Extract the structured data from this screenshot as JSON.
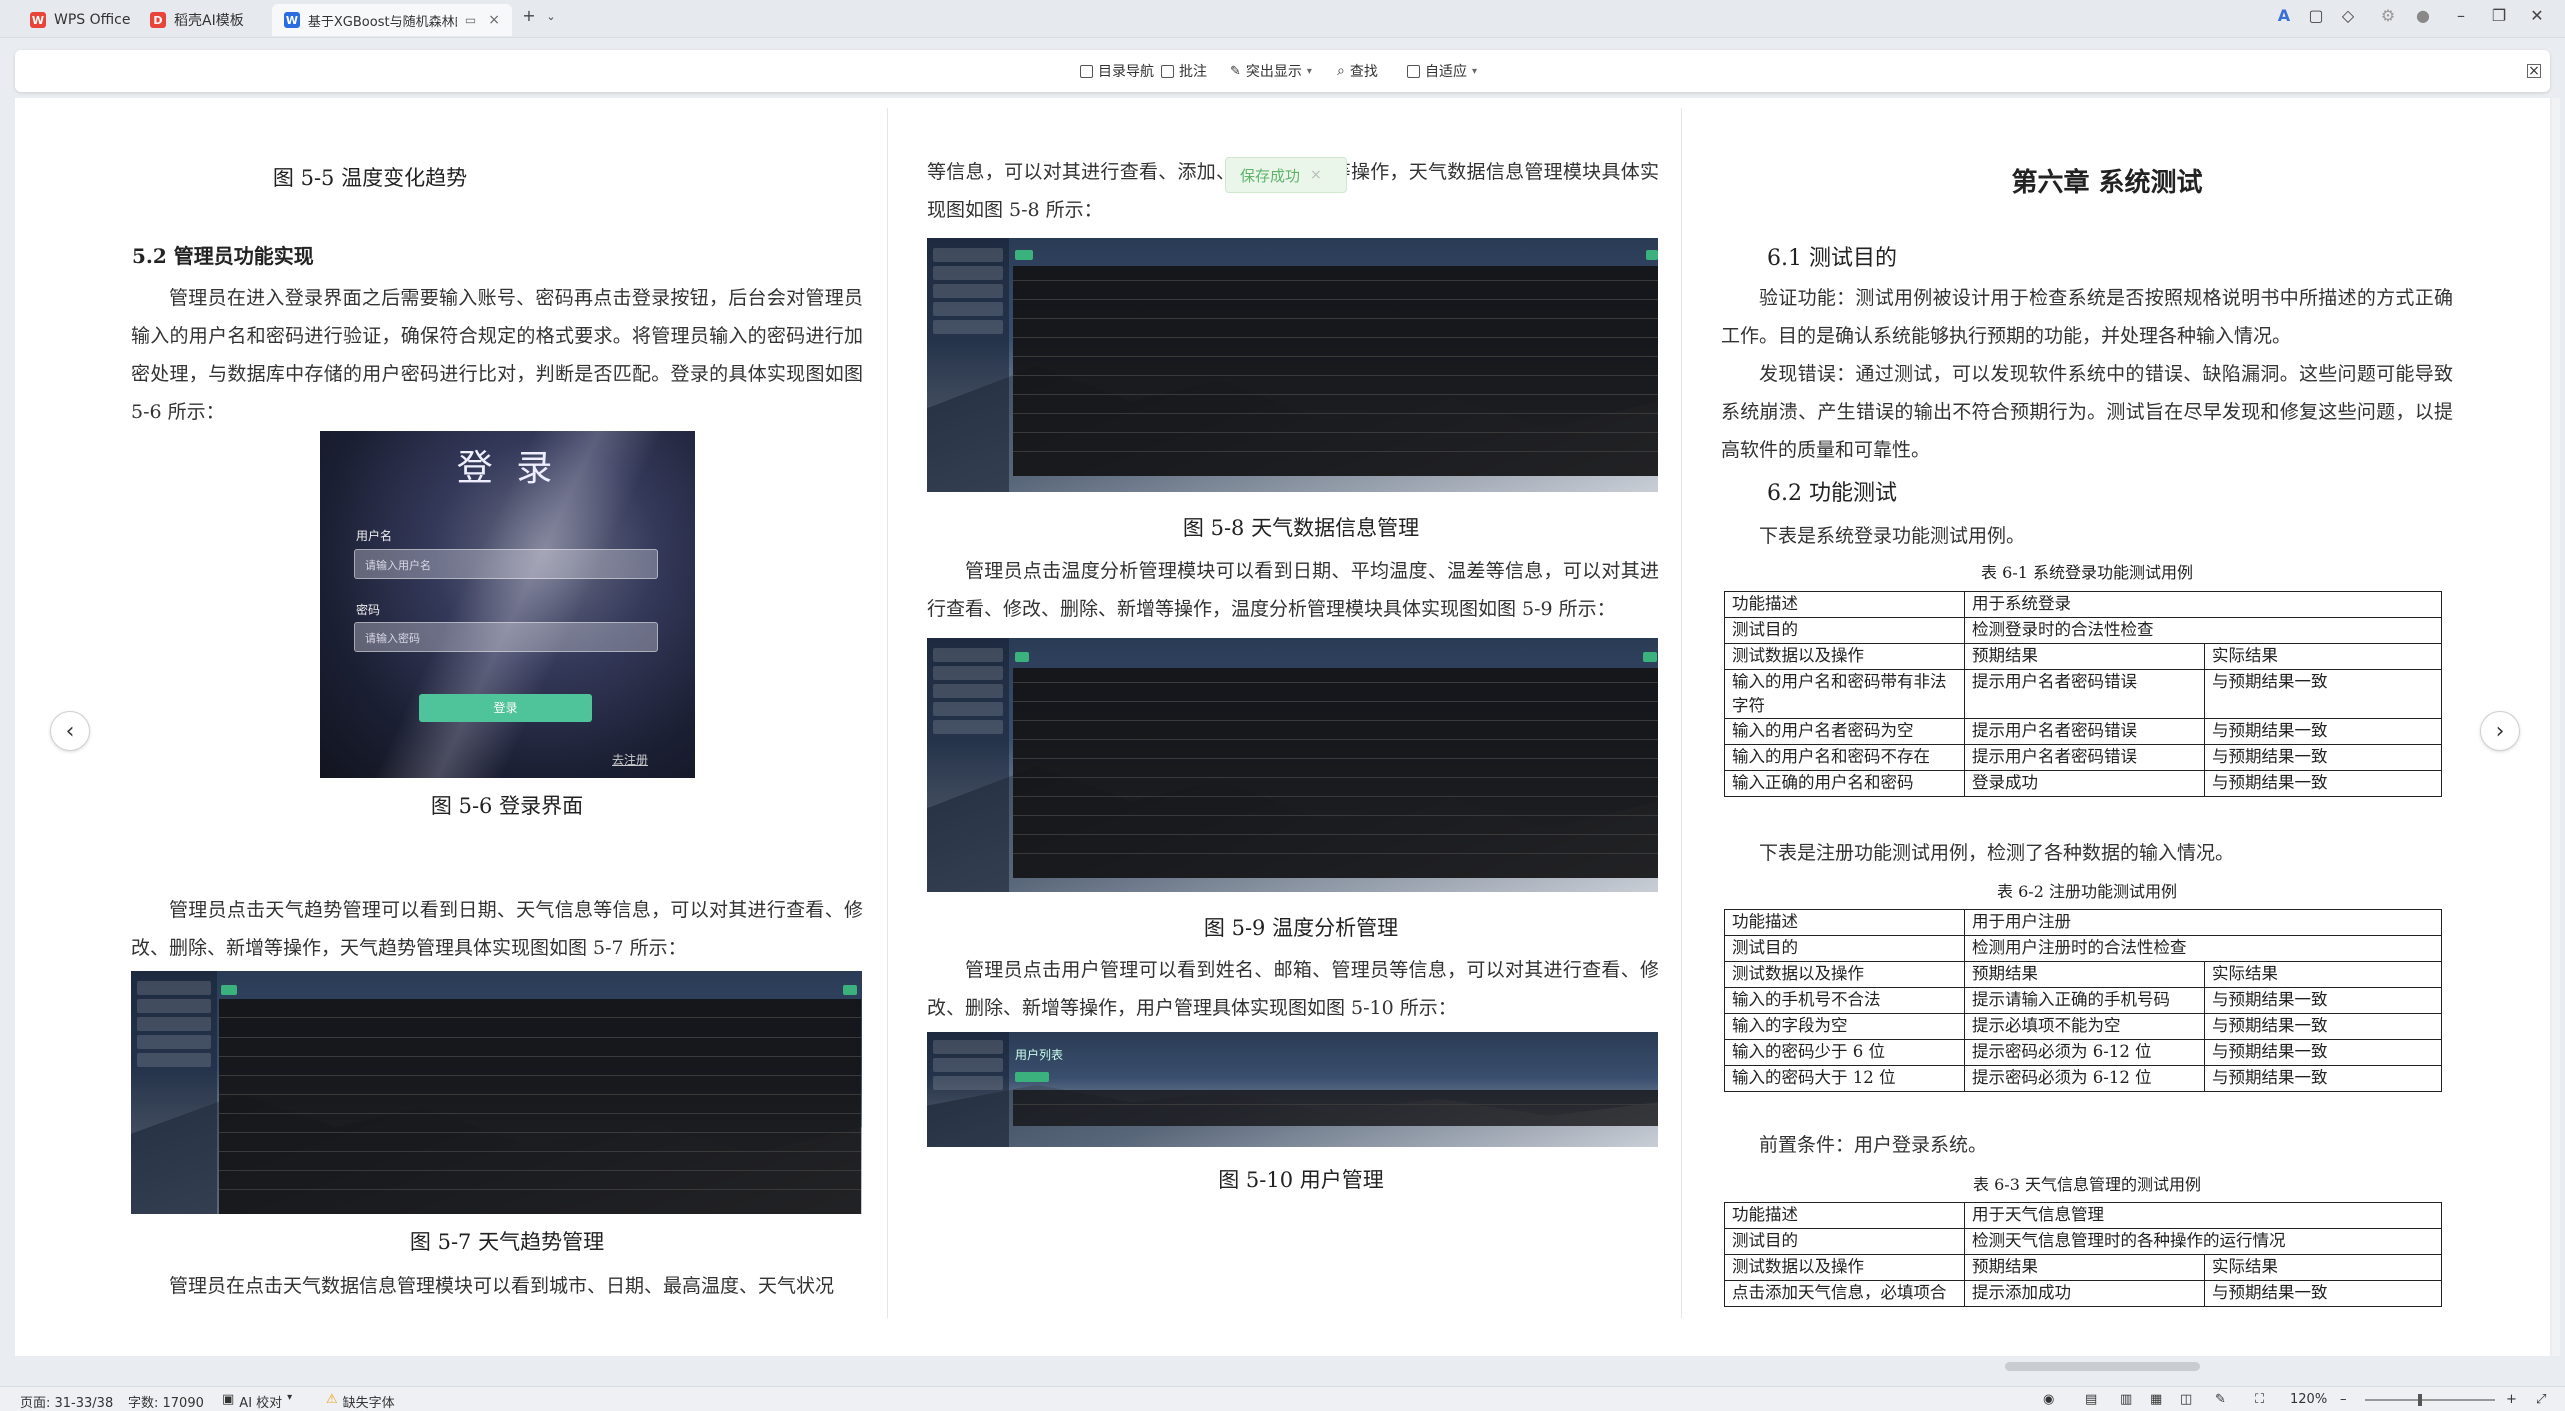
{
  "tabs": [
    {
      "label": "WPS Office",
      "logo": "W",
      "logo_color": "#e8443a"
    },
    {
      "label": "稻壳AI模板",
      "logo": "D",
      "logo_color": "#e8443a"
    },
    {
      "label": "基于XGBoost与随机森林的...",
      "logo": "W",
      "logo_color": "#2b6de1"
    }
  ],
  "toolbar": {
    "nav_label": "目录导航",
    "comment_label": "批注",
    "highlight_label": "突出显示",
    "find_label": "查找",
    "fit_label": "自适应"
  },
  "toast": {
    "text": "保存成功"
  },
  "col1": {
    "fig55_caption": "图 5-5 温度变化趋势",
    "section52": "5.2  管理员功能实现",
    "p1": "管理员在进入登录界面之后需要输入账号、密码再点击登录按钮，后台会对管理员输入的用户名和密码进行验证，确保符合规定的格式要求。将管理员输入的密码进行加密处理，与数据库中存储的用户密码进行比对，判断是否匹配。登录的具体实现图如图 5-6 所示：",
    "login": {
      "title": "登 录",
      "user_label": "用户名",
      "user_placeholder": "请输入用户名",
      "pwd_label": "密码",
      "pwd_placeholder": "请输入密码",
      "button": "登录",
      "register": "去注册"
    },
    "fig56_caption": "图 5-6 登录界面",
    "p2": "管理员点击天气趋势管理可以看到日期、天气信息等信息，可以对其进行查看、修改、删除、新增等操作，天气趋势管理具体实现图如图 5-7 所示：",
    "fig57_caption": "图 5-7  天气趋势管理",
    "p3": "管理员在点击天气数据信息管理模块可以看到城市、日期、最高温度、天气状况"
  },
  "col2": {
    "p1": "等信息，可以对其进行查看、添加、修改、删除等操作，天气数据信息管理模块具体实现图如图 5-8 所示：",
    "fig58_caption": "图 5-8  天气数据信息管理",
    "p2": "管理员点击温度分析管理模块可以看到日期、平均温度、温差等信息，可以对其进行查看、修改、删除、新增等操作，温度分析管理模块具体实现图如图 5-9 所示：",
    "fig59_caption": "图 5-9 温度分析管理",
    "p3": "管理员点击用户管理可以看到姓名、邮箱、管理员等信息，可以对其进行查看、修改、删除、新增等操作，用户管理具体实现图如图 5-10 所示：",
    "user_list_title": "用户列表",
    "fig510_caption": "图 5-10  用户管理"
  },
  "col3": {
    "chapter": "第六章  系统测试",
    "s61": "6.1  测试目的",
    "p1": "验证功能：测试用例被设计用于检查系统是否按照规格说明书中所描述的方式正确工作。目的是确认系统能够执行预期的功能，并处理各种输入情况。",
    "p2": "发现错误：通过测试，可以发现软件系统中的错误、缺陷漏洞。这些问题可能导致系统崩溃、产生错误的输出不符合预期行为。测试旨在尽早发现和修复这些问题，以提高软件的质量和可靠性。",
    "s62": "6.2  功能测试",
    "intro1": "下表是系统登录功能测试用例。",
    "t61_caption": "表 6-1  系统登录功能测试用例",
    "t61": [
      [
        "功能描述",
        "用于系统登录",
        ""
      ],
      [
        "测试目的",
        "检测登录时的合法性检查",
        ""
      ],
      [
        "测试数据以及操作",
        "预期结果",
        "实际结果"
      ],
      [
        "输入的用户名和密码带有非法字符",
        "提示用户名者密码错误",
        "与预期结果一致"
      ],
      [
        "输入的用户名者密码为空",
        "提示用户名者密码错误",
        "与预期结果一致"
      ],
      [
        "输入的用户名和密码不存在",
        "提示用户名者密码错误",
        "与预期结果一致"
      ],
      [
        "输入正确的用户名和密码",
        "登录成功",
        "与预期结果一致"
      ]
    ],
    "intro2": "下表是注册功能测试用例，检测了各种数据的输入情况。",
    "t62_caption": "表 6-2  注册功能测试用例",
    "t62": [
      [
        "功能描述",
        "用于用户注册",
        ""
      ],
      [
        "测试目的",
        "检测用户注册时的合法性检查",
        ""
      ],
      [
        "测试数据以及操作",
        "预期结果",
        "实际结果"
      ],
      [
        "输入的手机号不合法",
        "提示请输入正确的手机号码",
        "与预期结果一致"
      ],
      [
        "输入的字段为空",
        "提示必填项不能为空",
        "与预期结果一致"
      ],
      [
        "输入的密码少于 6 位",
        "提示密码必须为 6-12 位",
        "与预期结果一致"
      ],
      [
        "输入的密码大于 12 位",
        "提示密码必须为 6-12 位",
        "与预期结果一致"
      ]
    ],
    "intro3": "前置条件：用户登录系统。",
    "t63_caption": "表 6-3  天气信息管理的测试用例",
    "t63": [
      [
        "功能描述",
        "用于天气信息管理",
        ""
      ],
      [
        "测试目的",
        "检测天气信息管理时的各种操作的运行情况",
        ""
      ],
      [
        "测试数据以及操作",
        "预期结果",
        "实际结果"
      ],
      [
        "点击添加天气信息，必填项合",
        "提示添加成功",
        "与预期结果一致"
      ]
    ]
  },
  "status": {
    "page": "页面: 31-33/38",
    "words": "字数: 17090",
    "ai_check": "AI 校对",
    "missing_font": "缺失字体",
    "zoom": "120%"
  }
}
